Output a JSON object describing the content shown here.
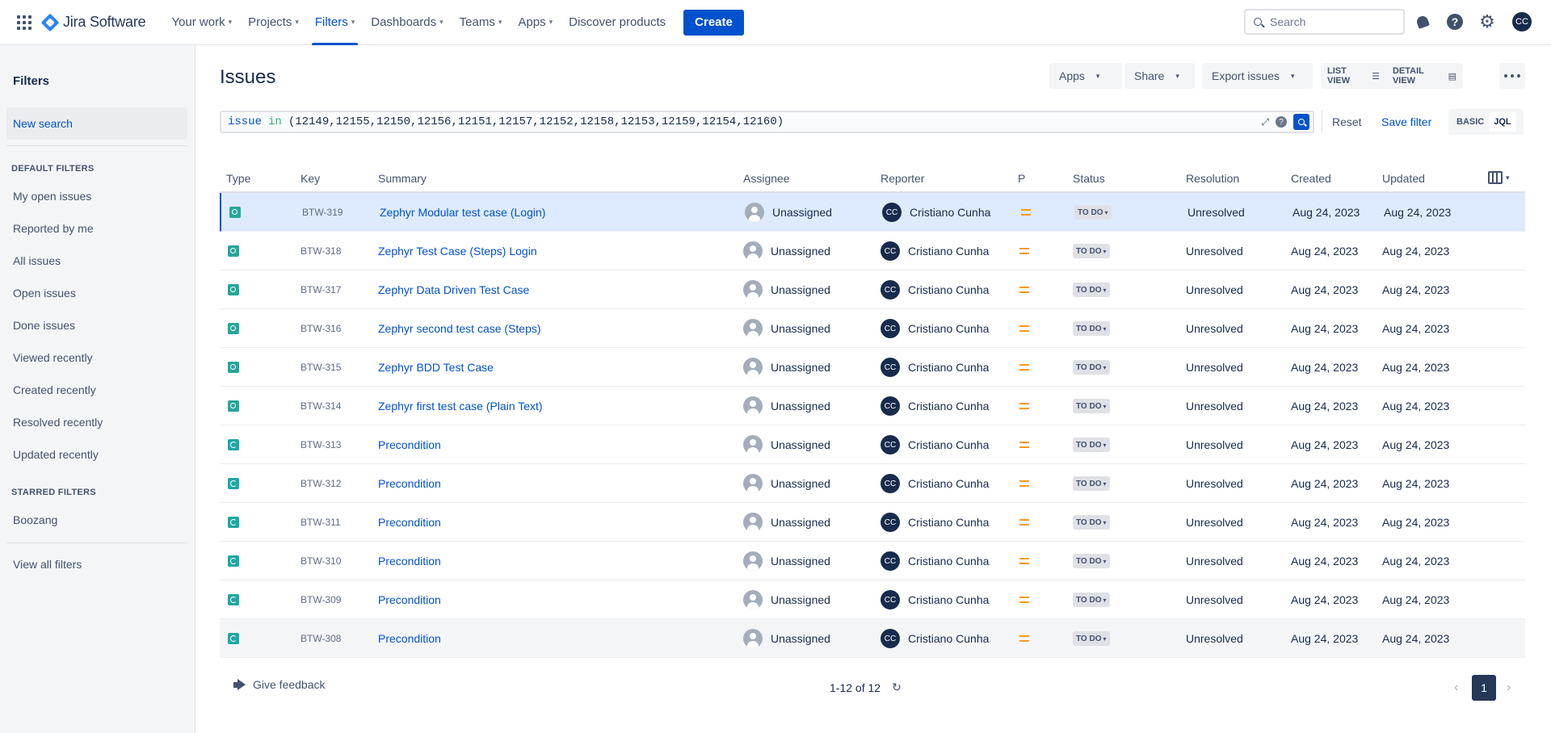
{
  "nav": {
    "logo": "Jira Software",
    "items": [
      {
        "label": "Your work",
        "chevron": true
      },
      {
        "label": "Projects",
        "chevron": true
      },
      {
        "label": "Filters",
        "chevron": true,
        "active": true
      },
      {
        "label": "Dashboards",
        "chevron": true
      },
      {
        "label": "Teams",
        "chevron": true
      },
      {
        "label": "Apps",
        "chevron": true
      },
      {
        "label": "Discover products",
        "chevron": false
      }
    ],
    "create": "Create",
    "search_placeholder": "Search",
    "avatar": "CC"
  },
  "sidebar": {
    "title": "Filters",
    "new_search": "New search",
    "default_heading": "DEFAULT FILTERS",
    "default_filters": [
      "My open issues",
      "Reported by me",
      "All issues",
      "Open issues",
      "Done issues",
      "Viewed recently",
      "Created recently",
      "Resolved recently",
      "Updated recently"
    ],
    "starred_heading": "STARRED FILTERS",
    "starred_filters": [
      "Boozang"
    ],
    "view_all": "View all filters"
  },
  "main": {
    "title": "Issues",
    "apps": "Apps",
    "share": "Share",
    "export": "Export issues",
    "list_view": "LIST VIEW",
    "detail_view": "DETAIL VIEW",
    "jql_keyword": "issue",
    "jql_operator": "in",
    "jql_values": "(12149,12155,12150,12156,12151,12157,12152,12158,12153,12159,12154,12160)",
    "reset": "Reset",
    "save_filter": "Save filter",
    "basic": "BASIC",
    "jql": "JQL"
  },
  "table": {
    "columns": [
      "Type",
      "Key",
      "Summary",
      "Assignee",
      "Reporter",
      "P",
      "Status",
      "Resolution",
      "Created",
      "Updated"
    ],
    "rows": [
      {
        "type": "test",
        "key": "BTW-319",
        "summary": "Zephyr Modular test case (Login)",
        "assignee": "Unassigned",
        "reporter": "Cristiano Cunha",
        "reporter_initials": "CC",
        "status": "TO DO",
        "resolution": "Unresolved",
        "created": "Aug 24, 2023",
        "updated": "Aug 24, 2023"
      },
      {
        "type": "test",
        "key": "BTW-318",
        "summary": "Zephyr Test Case (Steps) Login",
        "assignee": "Unassigned",
        "reporter": "Cristiano Cunha",
        "reporter_initials": "CC",
        "status": "TO DO",
        "resolution": "Unresolved",
        "created": "Aug 24, 2023",
        "updated": "Aug 24, 2023"
      },
      {
        "type": "test",
        "key": "BTW-317",
        "summary": "Zephyr Data Driven Test Case",
        "assignee": "Unassigned",
        "reporter": "Cristiano Cunha",
        "reporter_initials": "CC",
        "status": "TO DO",
        "resolution": "Unresolved",
        "created": "Aug 24, 2023",
        "updated": "Aug 24, 2023"
      },
      {
        "type": "test",
        "key": "BTW-316",
        "summary": "Zephyr second test case (Steps)",
        "assignee": "Unassigned",
        "reporter": "Cristiano Cunha",
        "reporter_initials": "CC",
        "status": "TO DO",
        "resolution": "Unresolved",
        "created": "Aug 24, 2023",
        "updated": "Aug 24, 2023"
      },
      {
        "type": "test",
        "key": "BTW-315",
        "summary": "Zephyr BDD Test Case",
        "assignee": "Unassigned",
        "reporter": "Cristiano Cunha",
        "reporter_initials": "CC",
        "status": "TO DO",
        "resolution": "Unresolved",
        "created": "Aug 24, 2023",
        "updated": "Aug 24, 2023"
      },
      {
        "type": "test",
        "key": "BTW-314",
        "summary": "Zephyr first test case (Plain Text)",
        "assignee": "Unassigned",
        "reporter": "Cristiano Cunha",
        "reporter_initials": "CC",
        "status": "TO DO",
        "resolution": "Unresolved",
        "created": "Aug 24, 2023",
        "updated": "Aug 24, 2023"
      },
      {
        "type": "precondition",
        "key": "BTW-313",
        "summary": "Precondition",
        "assignee": "Unassigned",
        "reporter": "Cristiano Cunha",
        "reporter_initials": "CC",
        "status": "TO DO",
        "resolution": "Unresolved",
        "created": "Aug 24, 2023",
        "updated": "Aug 24, 2023"
      },
      {
        "type": "precondition",
        "key": "BTW-312",
        "summary": "Precondition",
        "assignee": "Unassigned",
        "reporter": "Cristiano Cunha",
        "reporter_initials": "CC",
        "status": "TO DO",
        "resolution": "Unresolved",
        "created": "Aug 24, 2023",
        "updated": "Aug 24, 2023"
      },
      {
        "type": "precondition",
        "key": "BTW-311",
        "summary": "Precondition",
        "assignee": "Unassigned",
        "reporter": "Cristiano Cunha",
        "reporter_initials": "CC",
        "status": "TO DO",
        "resolution": "Unresolved",
        "created": "Aug 24, 2023",
        "updated": "Aug 24, 2023"
      },
      {
        "type": "precondition",
        "key": "BTW-310",
        "summary": "Precondition",
        "assignee": "Unassigned",
        "reporter": "Cristiano Cunha",
        "reporter_initials": "CC",
        "status": "TO DO",
        "resolution": "Unresolved",
        "created": "Aug 24, 2023",
        "updated": "Aug 24, 2023"
      },
      {
        "type": "precondition",
        "key": "BTW-309",
        "summary": "Precondition",
        "assignee": "Unassigned",
        "reporter": "Cristiano Cunha",
        "reporter_initials": "CC",
        "status": "TO DO",
        "resolution": "Unresolved",
        "created": "Aug 24, 2023",
        "updated": "Aug 24, 2023"
      },
      {
        "type": "precondition",
        "key": "BTW-308",
        "summary": "Precondition",
        "assignee": "Unassigned",
        "reporter": "Cristiano Cunha",
        "reporter_initials": "CC",
        "status": "TO DO",
        "resolution": "Unresolved",
        "created": "Aug 24, 2023",
        "updated": "Aug 24, 2023"
      }
    ]
  },
  "footer": {
    "feedback": "Give feedback",
    "count": "1-12 of 12",
    "page": "1"
  },
  "colors": {
    "accent": "#0052cc",
    "selected_row": "#deebff",
    "priority_medium": "#ff991f"
  }
}
